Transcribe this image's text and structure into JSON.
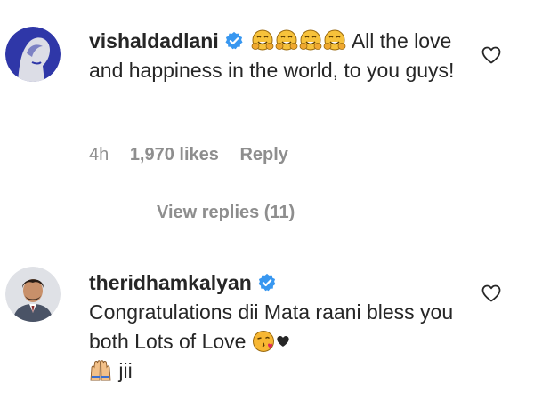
{
  "comments": [
    {
      "username": "vishaldadlani",
      "verified": true,
      "text": "All the love and happiness in the world, to you guys!",
      "timestamp": "4h",
      "likes": "1,970 likes",
      "reply_label": "Reply",
      "view_replies": "View replies (11)",
      "emoji": [
        "smiling-face-with-hands-emoji",
        "smiling-face-with-hands-emoji",
        "smiling-face-with-hands-emoji",
        "smiling-face-with-hands-emoji"
      ]
    },
    {
      "username": "theridhamkalyan",
      "verified": true,
      "text_1": "Congratulations dii Mata raani bless you both Lots of Love",
      "text_2": "jii",
      "emoji": [
        "face-blowing-kiss-emoji",
        "black-heart-emoji",
        "raised-hands-emoji"
      ]
    }
  ],
  "colors": {
    "text": "#262626",
    "muted": "#8e8e8e",
    "verified_blue": "#3897f0"
  }
}
